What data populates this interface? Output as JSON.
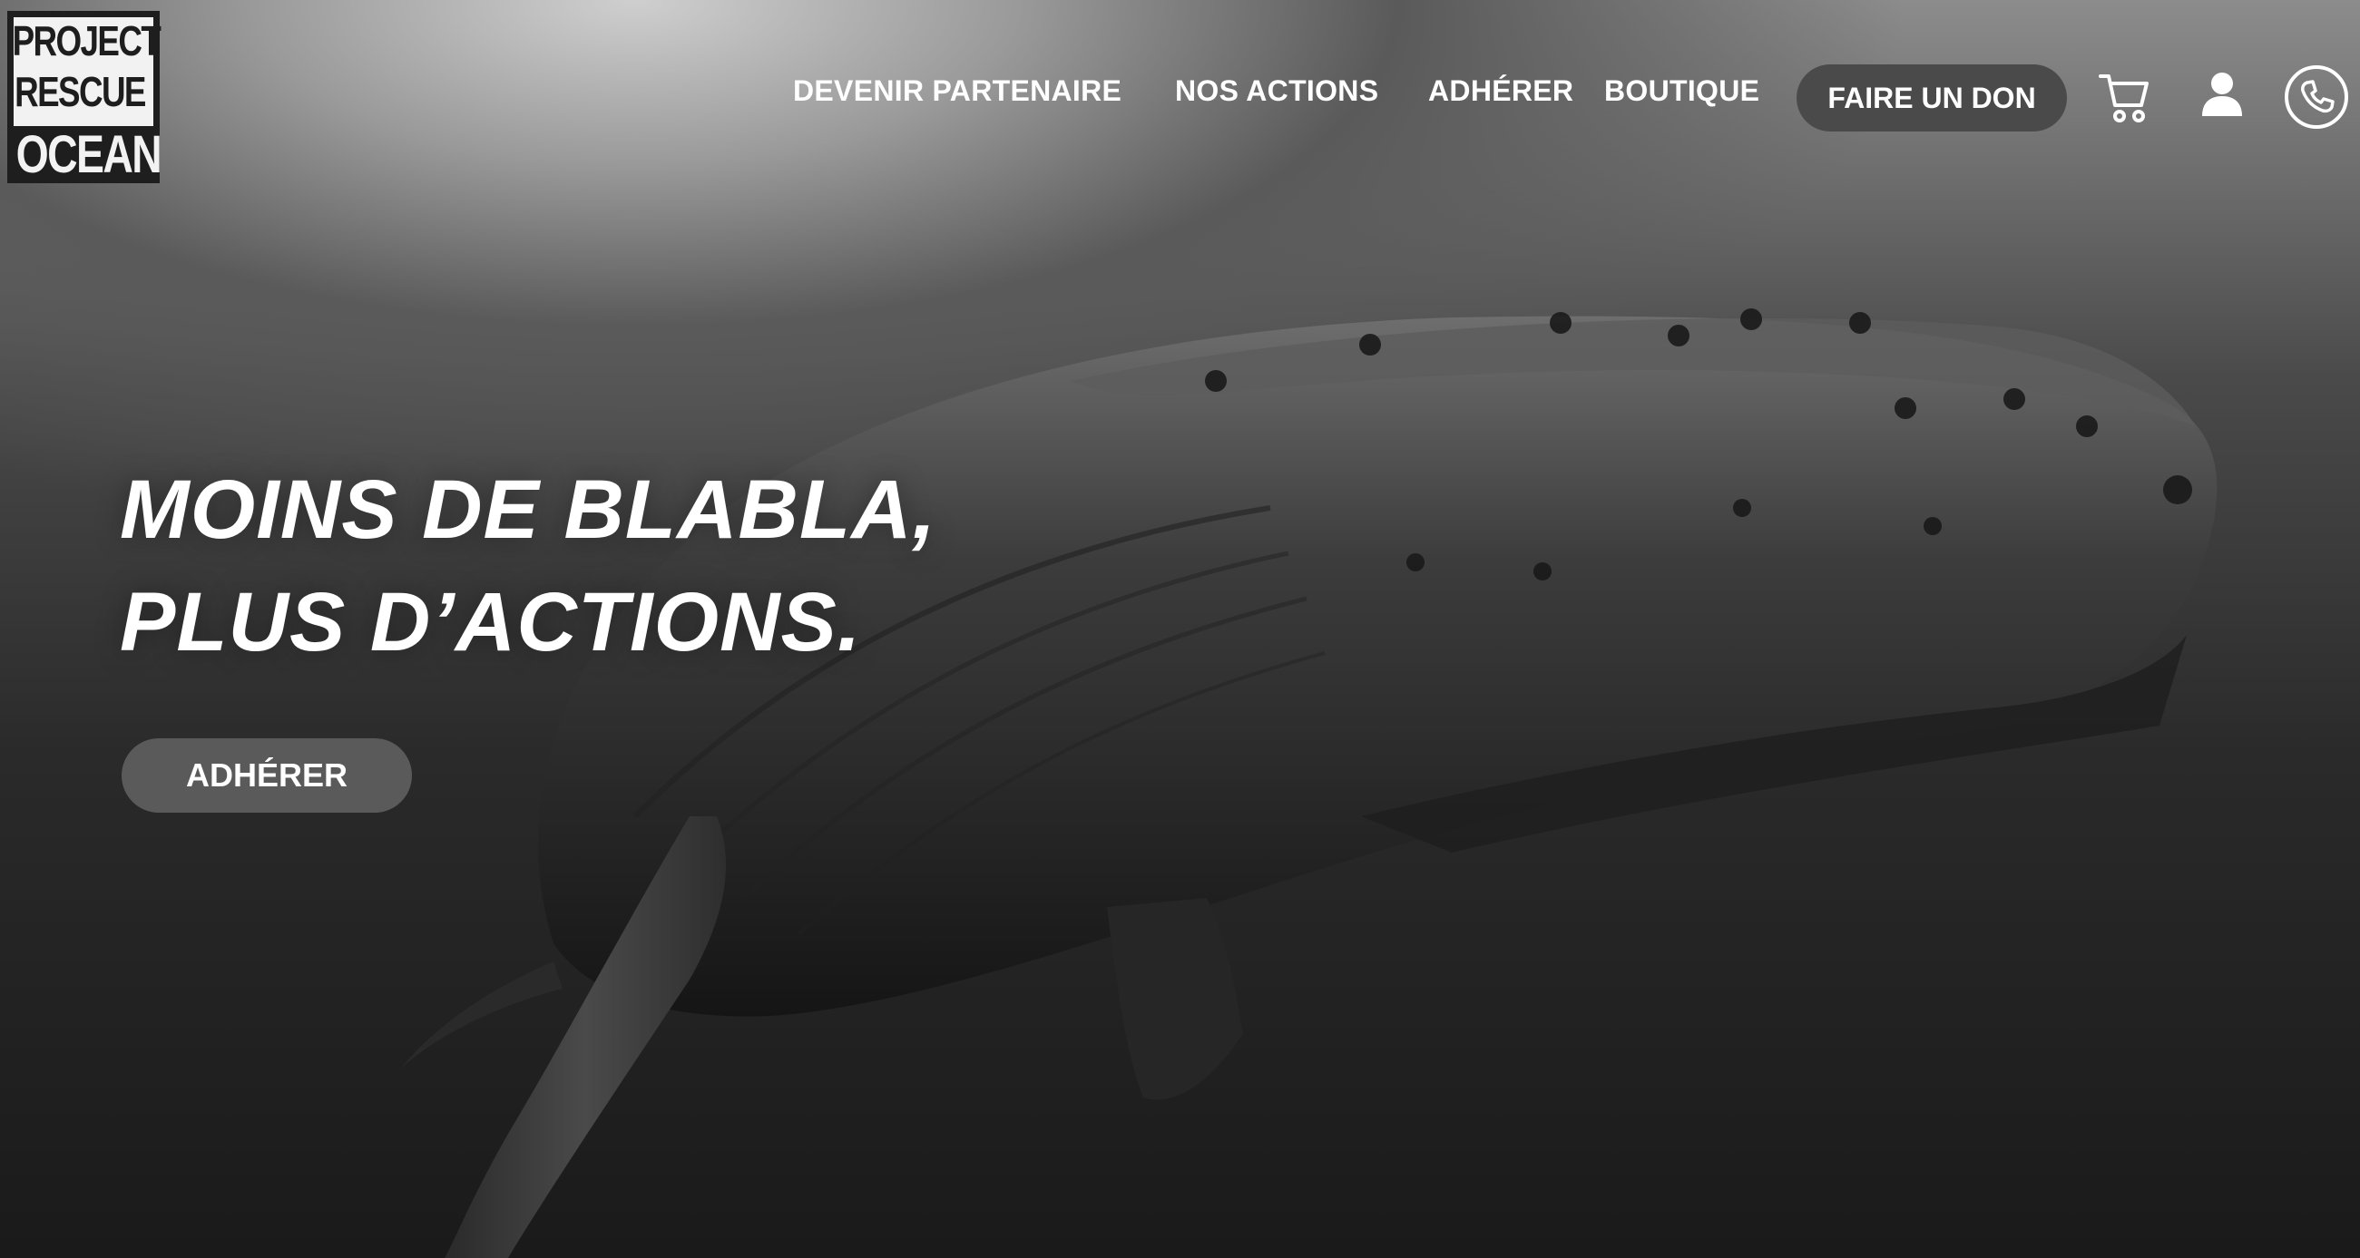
{
  "logo": {
    "line1": "PROJECT",
    "line2": "RESCUE",
    "line3": "OCEAN"
  },
  "nav": {
    "items": [
      {
        "label": "DEVENIR PARTENAIRE"
      },
      {
        "label": "NOS ACTIONS"
      },
      {
        "label": "ADHÉRER"
      },
      {
        "label": "BOUTIQUE"
      }
    ],
    "donate_label": "FAIRE UN DON",
    "icons": [
      "cart-icon",
      "user-icon",
      "phone-icon"
    ]
  },
  "hero": {
    "headline_line1": "MOINS DE BLABLA,",
    "headline_line2": "PLUS D’ACTIONS.",
    "cta_label": "ADHÉRER"
  },
  "colors": {
    "button_bg": "#4a4a4a",
    "text": "#ffffff"
  }
}
